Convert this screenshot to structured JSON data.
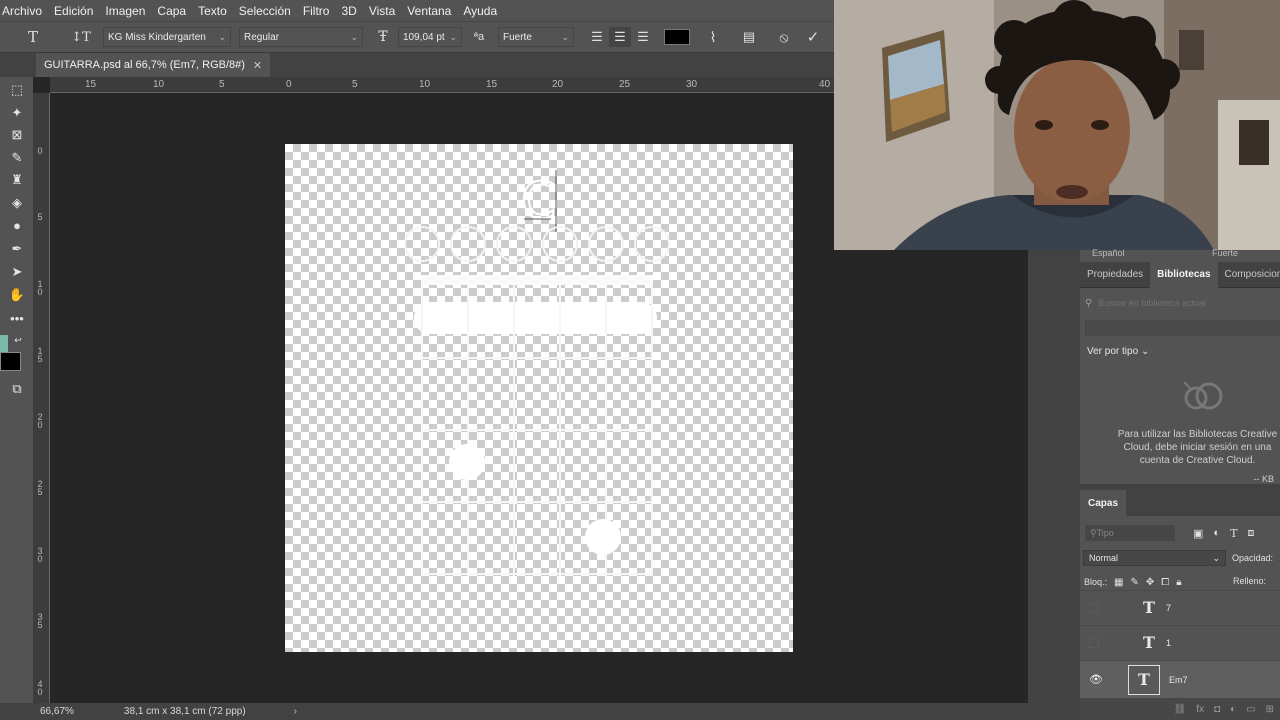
{
  "menubar": [
    "Archivo",
    "Edición",
    "Imagen",
    "Capa",
    "Texto",
    "Selección",
    "Filtro",
    "3D",
    "Vista",
    "Ventana",
    "Ayuda"
  ],
  "options": {
    "tool_icon": "type-tool-icon",
    "font_family": "KG Miss Kindergarten",
    "font_style": "Regular",
    "font_size": "109,04 pt",
    "antialias": "Fuerte",
    "text_color": "#000000"
  },
  "document": {
    "tab_title": "GUITARRA.psd al 66,7% (Em7, RGB/8#)"
  },
  "rulers": {
    "h_ticks": [
      "15",
      "10",
      "5",
      "0",
      "5",
      "10",
      "15",
      "20",
      "25",
      "30",
      "40"
    ],
    "v_ticks": [
      "0",
      "5",
      "1\n0",
      "1\n5",
      "2\n0",
      "2\n5",
      "3\n0",
      "3\n5",
      "4\n0"
    ]
  },
  "canvas": {
    "chord_name_placeholder": "C"
  },
  "status": {
    "zoom": "66,67%",
    "doc_size": "38,1 cm x 38,1 cm (72 ppp)"
  },
  "right_panel": {
    "lang": "Español",
    "antialias": "Fuerte",
    "tabs": [
      "Propiedades",
      "Bibliotecas",
      "Composiciones de"
    ],
    "active_tab": "Bibliotecas",
    "search_placeholder": "Buscar en biblioteca actual",
    "view_by_type": "Ver por tipo",
    "library_message": "Para utilizar las Bibliotecas Creative Cloud, debe iniciar sesión en una cuenta de Creative Cloud.",
    "kb_label": "-- KB"
  },
  "layers_panel": {
    "title": "Capas",
    "filter_placeholder": "Tipo",
    "blend_mode": "Normal",
    "opacity_label": "Opacidad:",
    "lock_label": "Bloq.:",
    "fill_label": "Relleno:",
    "layers": [
      {
        "name": "7",
        "visible": false,
        "selected": false
      },
      {
        "name": "1",
        "visible": false,
        "selected": false
      },
      {
        "name": "Em7",
        "visible": true,
        "selected": true
      }
    ]
  },
  "colors": {
    "foreground": "#7ab8a8",
    "background": "#000000",
    "panel": "#535353",
    "workspace": "#262626"
  }
}
